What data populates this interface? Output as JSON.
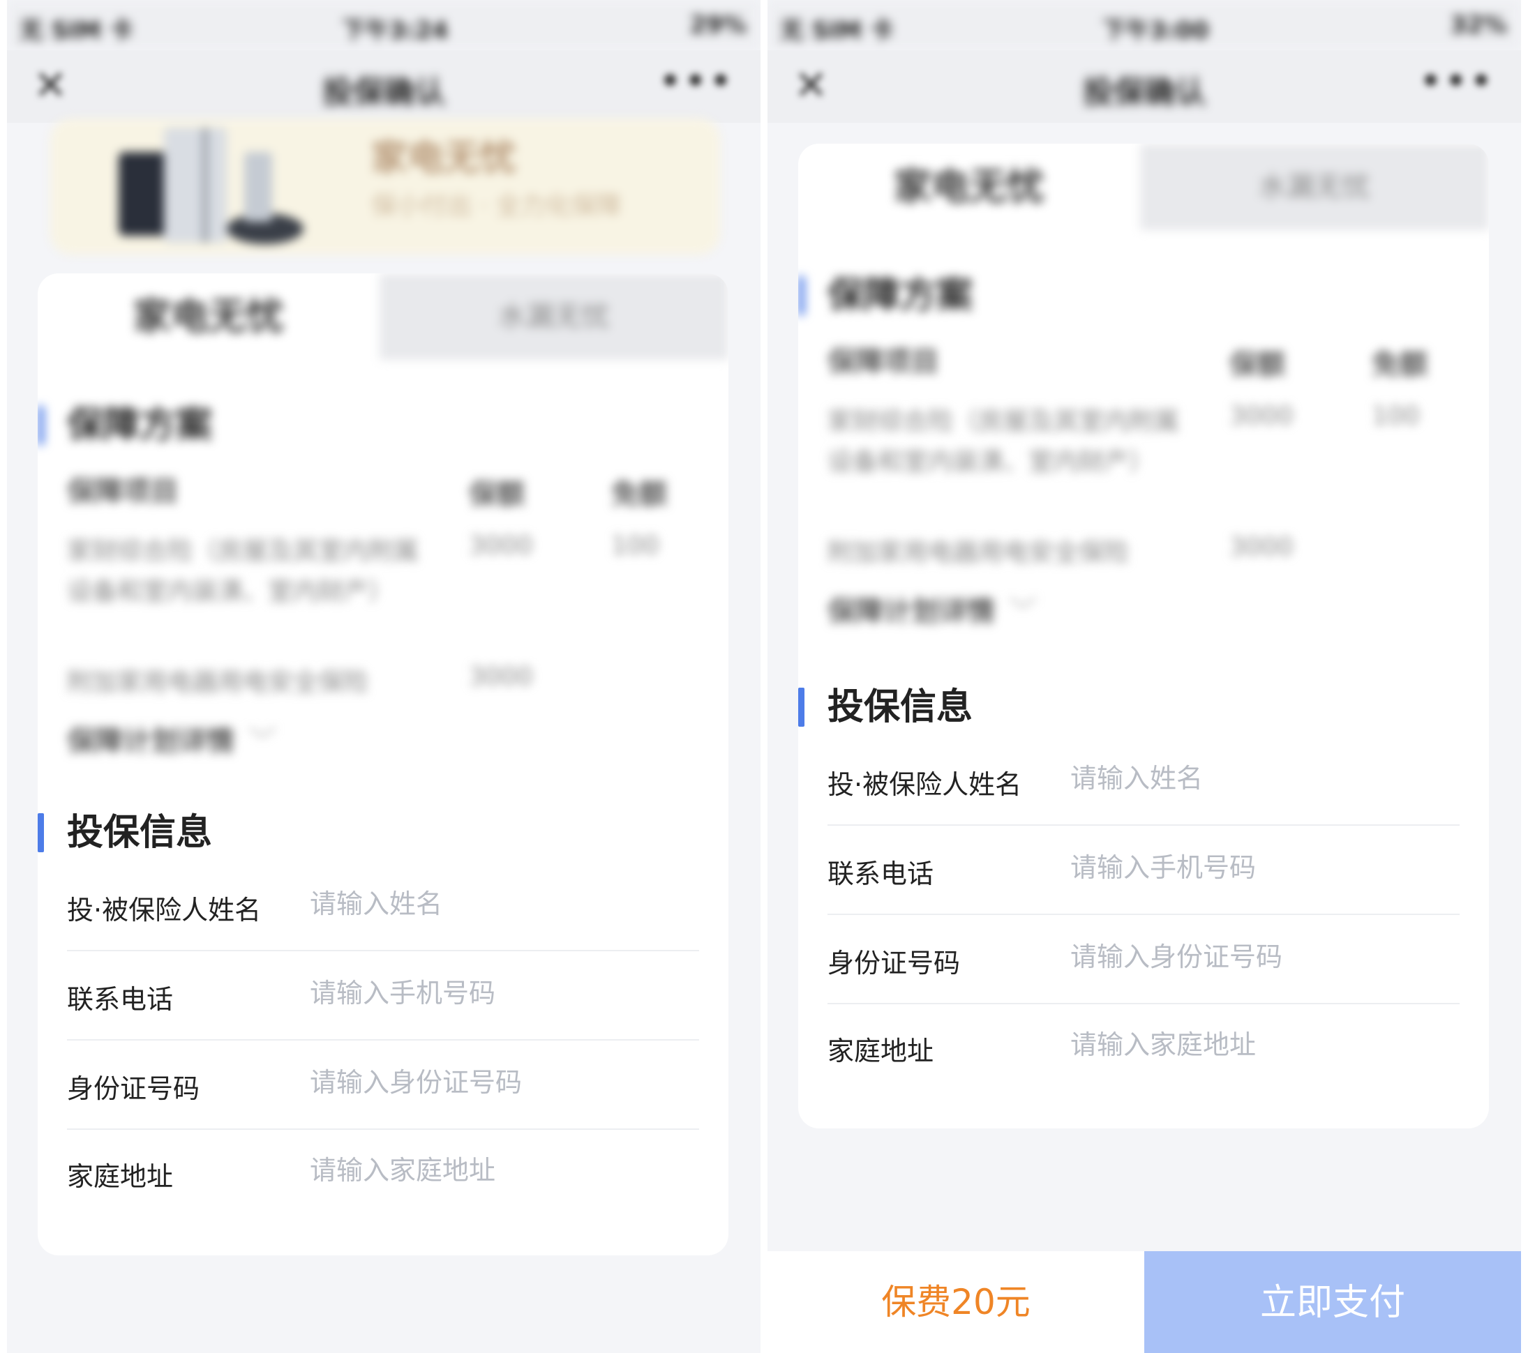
{
  "status_bar": {
    "left": {
      "carrier": "无 SIM 卡",
      "time": "下午3:24",
      "battery": "29%"
    },
    "right": {
      "carrier": "无 SIM 卡",
      "time": "下午3:00",
      "battery": "32%"
    }
  },
  "nav": {
    "close_icon": "✕",
    "title": "投保确认",
    "more_icon": "•••"
  },
  "banner": {
    "title": "家电无忧",
    "subtitle": "保小付出 · 全力化保障"
  },
  "tabs": [
    {
      "label": "家电无忧",
      "active": true
    },
    {
      "label": "水漏无忧",
      "active": false
    }
  ],
  "coverage": {
    "title": "保障方案",
    "headers": {
      "item": "保障项目",
      "amount": "保额",
      "deductible": "免额"
    },
    "rows": [
      {
        "item": "家财综合险（房屋及其室内附属设备和室内装潢、室内财产）",
        "amount": "3000",
        "deductible": "100"
      },
      {
        "item": "附加家用电器用电安全保险",
        "amount": "3000",
        "deductible": ""
      }
    ],
    "details_link": "保障计划详情",
    "details_chevron": "﹀"
  },
  "insured_info": {
    "title": "投保信息",
    "fields": [
      {
        "label": "投·被保险人姓名",
        "placeholder": "请输入姓名"
      },
      {
        "label": "联系电话",
        "placeholder": "请输入手机号码"
      },
      {
        "label": "身份证号码",
        "placeholder": "请输入身份证号码"
      },
      {
        "label": "家庭地址",
        "placeholder": "请输入家庭地址"
      }
    ]
  },
  "footer": {
    "premium": "保费20元",
    "pay_button": "立即支付"
  },
  "colors": {
    "accent": "#4d7ce8",
    "premium": "#ef8526",
    "pay_button_bg": "#a8c1f7",
    "banner_bg": "#f8f4e4"
  }
}
